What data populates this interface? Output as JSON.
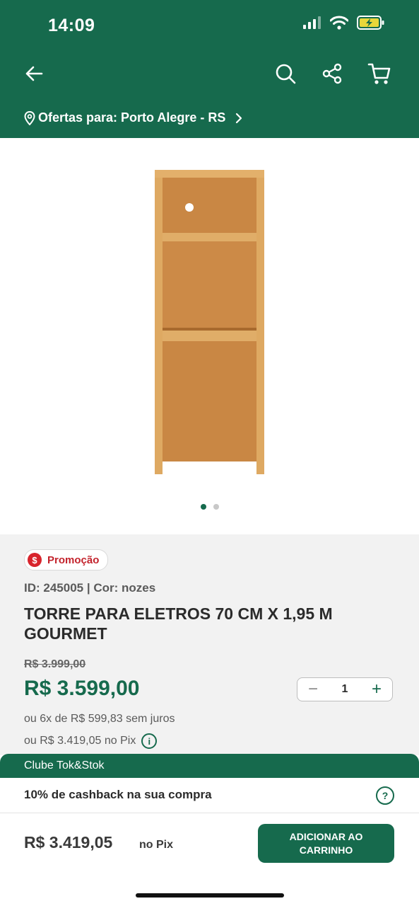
{
  "status_bar": {
    "time": "14:09"
  },
  "header": {
    "location_label": "Ofertas para: Porto Alegre - RS"
  },
  "icons": {
    "back": "arrow-left-icon",
    "search": "search-icon",
    "share": "share-icon",
    "cart": "cart-icon",
    "location": "location-pin-icon",
    "chevron": "chevron-right-icon"
  },
  "gallery": {
    "total_images": 2,
    "active_index": 0
  },
  "product": {
    "promo_label": "Promoção",
    "promo_icon_text": "$",
    "id_line": "ID: 245005 | Cor: nozes",
    "title": "TORRE PARA ELETROS 70 CM X 1,95 M GOURMET",
    "old_price": "R$ 3.999,00",
    "price": "R$ 3.599,00",
    "quantity": "1",
    "installments": "ou 6x de R$ 599,83 sem juros",
    "pix_line": "ou R$ 3.419,05 no Pix"
  },
  "clube": {
    "title": "Clube Tok&Stok",
    "cashback_text": "10% de cashback na sua compra",
    "help_icon_text": "?"
  },
  "footer": {
    "price": "R$ 3.419,05",
    "pix_label": "no Pix",
    "add_button_label": "ADICIONAR AO\nCARRINHO"
  },
  "colors": {
    "brand_green": "#166a4d",
    "promo_red": "#d8242c",
    "wood": "#d9a45c"
  }
}
